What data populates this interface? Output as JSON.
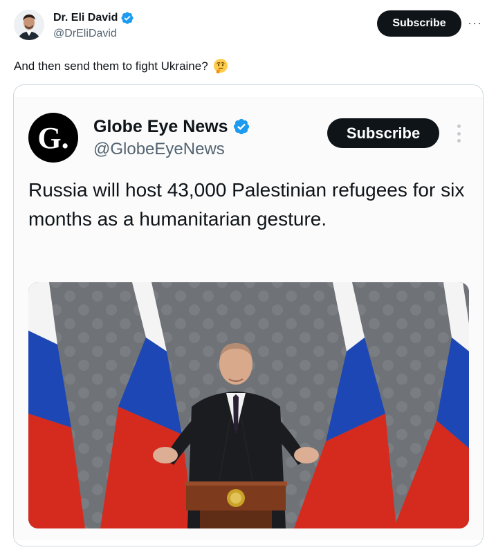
{
  "author": {
    "display_name": "Dr. Eli David",
    "handle": "@DrEliDavid",
    "subscribe_label": "Subscribe",
    "more_icon": "···"
  },
  "tweet": {
    "text": "And then send them to fight Ukraine?",
    "emoji_name": "thinking-face-emoji"
  },
  "quoted": {
    "logo_letter": "G.",
    "display_name": "Globe Eye News",
    "handle": "@GlobeEyeNews",
    "subscribe_label": "Subscribe",
    "text": "Russia will host 43,000 Palestinian refugees for six months as a humanitarian gesture.",
    "image_description_icon": "press-conference-photo"
  },
  "colors": {
    "verified": "#1d9bf0",
    "button_bg": "#0f1419",
    "secondary_text": "#536471",
    "flag_white": "#f4f4f4",
    "flag_blue": "#1c47b5",
    "flag_red": "#d52b1e"
  }
}
